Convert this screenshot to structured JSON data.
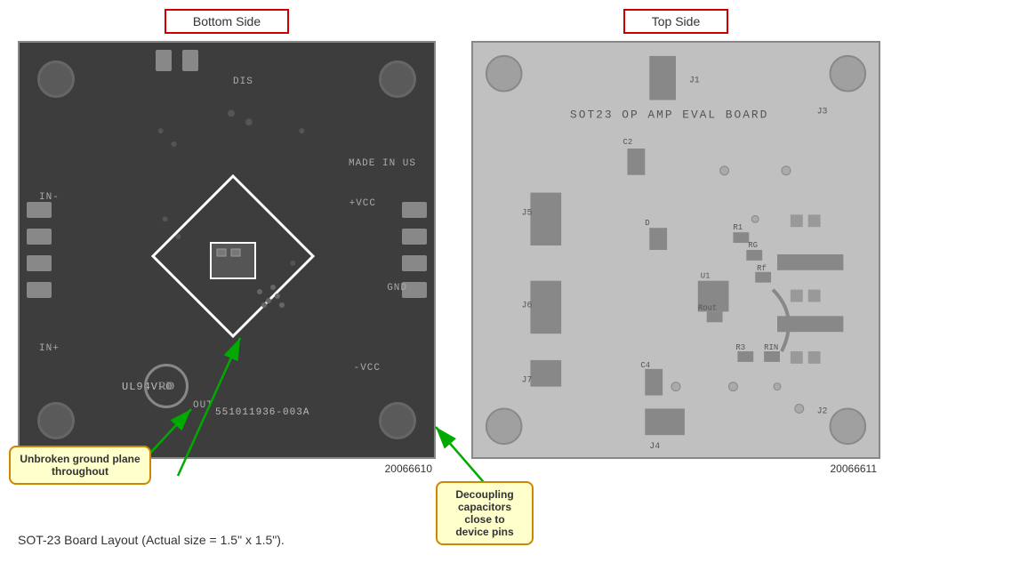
{
  "left_header": {
    "label": "Bottom Side",
    "border_color": "#cc0000"
  },
  "right_header": {
    "label": "Top Side",
    "border_color": "#cc0000"
  },
  "left_image_number": "20066610",
  "right_image_number": "20066611",
  "callout_left": {
    "text": "Unbroken ground plane throughout"
  },
  "callout_right": {
    "text": "Decoupling capacitors close to device pins"
  },
  "bottom_caption": "SOT-23 Board Layout (Actual size = 1.5\" x 1.5\").",
  "pcb_texts": {
    "dis": "DIS",
    "made_in_us": "MADE IN US",
    "vcc_plus": "+VCC",
    "gnd": "GND",
    "vcc_minus": "-VCC",
    "in_minus": "IN-",
    "in_plus": "IN+",
    "out": "OUT",
    "ul94": "UL94V-0",
    "part_number": "551011936-003A",
    "board_label": "SOT23 OP AMP EVAL BOARD",
    "j1": "J1",
    "j2": "J2",
    "j3": "J3",
    "j4": "J4",
    "j5": "J5",
    "j6": "J6",
    "j7": "J7",
    "c2": "C2",
    "c4": "C4",
    "u1": "U1",
    "r1": "R1",
    "r3": "R3",
    "rg": "RG",
    "rf": "Rf",
    "rin": "RIN",
    "rout": "Rout",
    "d": "D"
  }
}
